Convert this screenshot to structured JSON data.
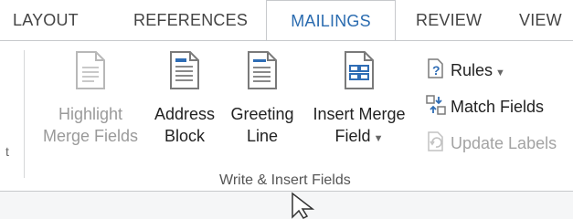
{
  "tabs": [
    {
      "label": "LAYOUT",
      "active": false
    },
    {
      "label": "REFERENCES",
      "active": false
    },
    {
      "label": "MAILINGS",
      "active": true
    },
    {
      "label": "REVIEW",
      "active": false
    },
    {
      "label": "VIEW",
      "active": false
    }
  ],
  "ribbon": {
    "left_edge_glyph": "t",
    "group_label": "Write & Insert Fields",
    "buttons": [
      {
        "line1": "Highlight",
        "line2": "Merge Fields",
        "icon": "document-icon",
        "enabled": false
      },
      {
        "line1": "Address",
        "line2": "Block",
        "icon": "address-block-icon",
        "enabled": true
      },
      {
        "line1": "Greeting",
        "line2": "Line",
        "icon": "greeting-line-icon",
        "enabled": true
      },
      {
        "line1": "Insert Merge",
        "line2": "Field",
        "icon": "insert-merge-field-icon",
        "enabled": true,
        "dropdown": true
      }
    ],
    "small_buttons": [
      {
        "label": "Rules",
        "icon": "rules-icon",
        "enabled": true,
        "dropdown": true
      },
      {
        "label": "Match Fields",
        "icon": "match-fields-icon",
        "enabled": true
      },
      {
        "label": "Update Labels",
        "icon": "update-labels-icon",
        "enabled": false
      }
    ]
  },
  "colors": {
    "active_tab_text": "#2b6cb0",
    "icon_blue": "#2f6db5",
    "disabled_text": "#9a9a9a"
  }
}
